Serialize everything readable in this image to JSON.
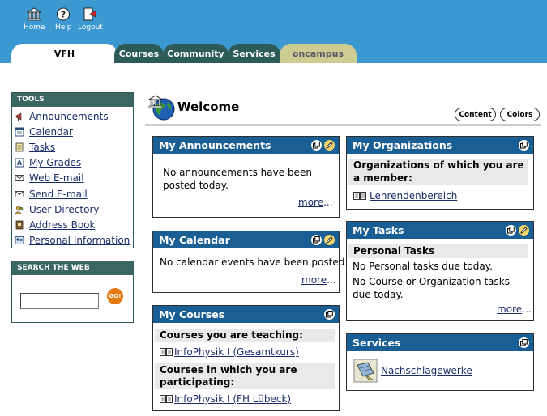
{
  "topnav": {
    "home_label": "Home",
    "help_label": "Help",
    "logout_label": "Logout"
  },
  "tabs": [
    {
      "label": "VFH",
      "active": true
    },
    {
      "label": "Courses"
    },
    {
      "label": "Community"
    },
    {
      "label": "Services"
    },
    {
      "label": "oncampus"
    }
  ],
  "tools": {
    "title": "TOOLS",
    "items": [
      {
        "label": "Announcements",
        "icon": "announcements-icon"
      },
      {
        "label": "Calendar",
        "icon": "calendar-icon"
      },
      {
        "label": "Tasks",
        "icon": "tasks-icon"
      },
      {
        "label": "My Grades",
        "icon": "grades-icon"
      },
      {
        "label": "Web E-mail",
        "icon": "web-email-icon"
      },
      {
        "label": "Send E-mail",
        "icon": "send-email-icon"
      },
      {
        "label": "User Directory",
        "icon": "user-directory-icon"
      },
      {
        "label": "Address Book",
        "icon": "address-book-icon"
      },
      {
        "label": "Personal Information",
        "icon": "personal-info-icon"
      }
    ]
  },
  "search": {
    "title": "SEARCH THE WEB",
    "value": "",
    "go_label": "GO!"
  },
  "welcome": {
    "title": "Welcome",
    "content_button": "Content",
    "colors_button": "Colors"
  },
  "announcements": {
    "title": "My Announcements",
    "text": "No announcements have been posted today.",
    "more": "more",
    "ellipsis": "..."
  },
  "calendar": {
    "title": "My Calendar",
    "text": "No calendar events have been posted.",
    "more": "more",
    "ellipsis": "..."
  },
  "courses": {
    "title": "My Courses",
    "teaching_heading": "Courses you are teaching:",
    "teaching": [
      "InfoPhysik I (Gesamtkurs)"
    ],
    "participating_heading": "Courses in which you are participating:",
    "participating": [
      "InfoPhysik I (FH Lübeck)"
    ]
  },
  "organizations": {
    "title": "My Organizations",
    "heading": "Organizations of which you are a member:",
    "items": [
      "Lehrendenbereich"
    ]
  },
  "tasks": {
    "title": "My Tasks",
    "heading": "Personal Tasks",
    "personal_text": "No Personal tasks due today.",
    "course_text": "No Course or Organization tasks due today.",
    "more": "more",
    "ellipsis": "..."
  },
  "services": {
    "title": "Services",
    "items": [
      "Nachschlagewerke"
    ]
  },
  "colors": {
    "header_blue": "#3b98d1",
    "tab_dark": "#2d5b58",
    "tab_oncampus": "#cfcc93",
    "module_header": "#1a5f94",
    "sidebar_header": "#3b6662",
    "go_button": "#e57b0f",
    "link": "#1c2d6a"
  }
}
